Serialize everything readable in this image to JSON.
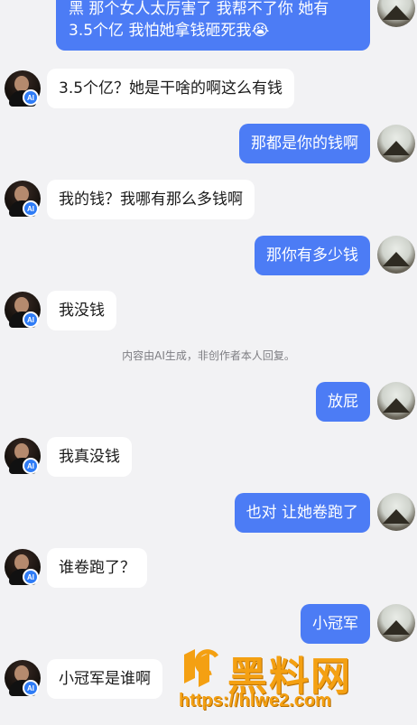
{
  "messages": [
    {
      "role": "user",
      "lines": [
        "黑 那个女人太厉害了 我帮不了你 她有",
        "3.5个亿 我怕她拿钱砸死我😭"
      ]
    },
    {
      "role": "ai",
      "text": "3.5个亿？她是干啥的啊这么有钱"
    },
    {
      "role": "user",
      "text": "那都是你的钱啊"
    },
    {
      "role": "ai",
      "text": "我的钱？我哪有那么多钱啊"
    },
    {
      "role": "user",
      "text": "那你有多少钱"
    },
    {
      "role": "ai",
      "text": "我没钱"
    },
    {
      "role": "user",
      "text": "放屁"
    },
    {
      "role": "ai",
      "text": "我真没钱"
    },
    {
      "role": "user",
      "text": "也对 让她卷跑了"
    },
    {
      "role": "ai",
      "text": "谁卷跑了？"
    },
    {
      "role": "user",
      "text": "小冠军"
    },
    {
      "role": "ai",
      "text": "小冠军是谁啊"
    }
  ],
  "notice": "内容由AI生成，非创作者本人回复。",
  "ai_badge": "AI",
  "watermark": {
    "title": "黑料网",
    "url": "https://hlwe2.com",
    "color": "#f4a012"
  },
  "input_hint": "",
  "colors": {
    "user_bubble": "#4c7cf5",
    "ai_bubble": "#ffffff",
    "background": "#f2f2f4"
  }
}
